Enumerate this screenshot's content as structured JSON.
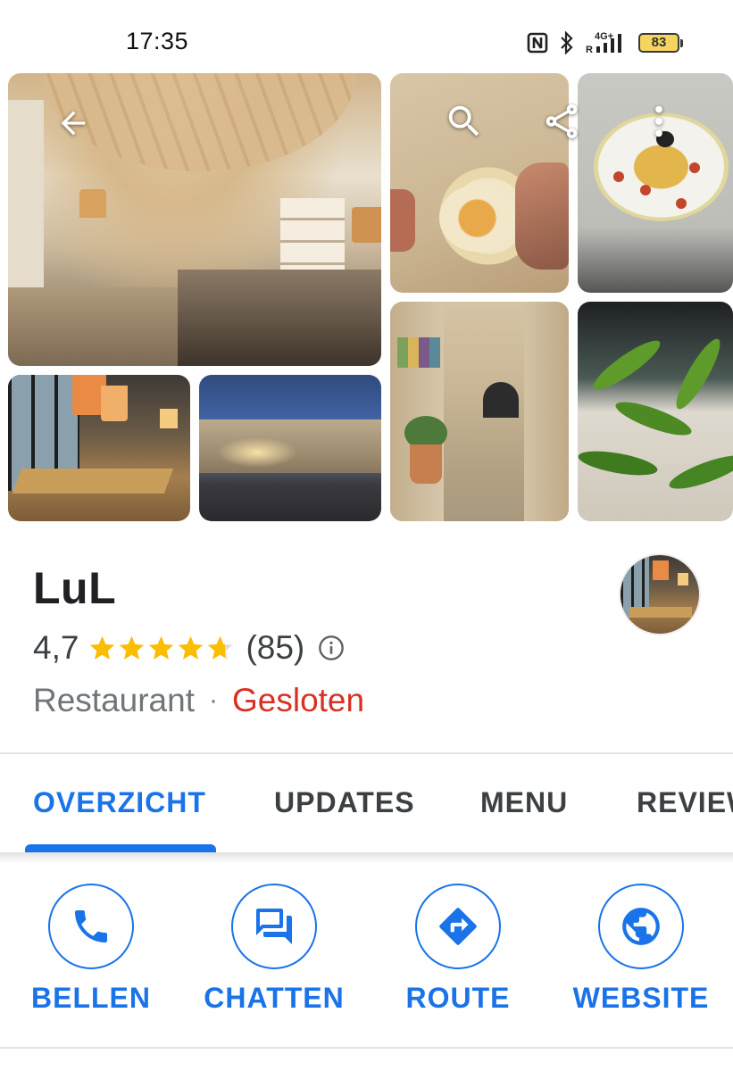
{
  "status_bar": {
    "time": "17:35",
    "battery": "83",
    "network": "4G+"
  },
  "place": {
    "name": "LuL",
    "rating": "4,7",
    "stars": 4.7,
    "review_count": "(85)",
    "category": "Restaurant",
    "separator": "·",
    "open_status": "Gesloten"
  },
  "tabs": [
    {
      "label": "OVERZICHT",
      "active": true
    },
    {
      "label": "UPDATES",
      "active": false
    },
    {
      "label": "MENU",
      "active": false
    },
    {
      "label": "REVIEWS",
      "active": false
    }
  ],
  "actions": [
    {
      "label": "BELLEN",
      "icon": "phone-icon"
    },
    {
      "label": "CHATTEN",
      "icon": "chat-icon"
    },
    {
      "label": "ROUTE",
      "icon": "directions-icon"
    },
    {
      "label": "WEBSITE",
      "icon": "globe-icon"
    }
  ],
  "colors": {
    "accent": "#1a73e8",
    "star": "#fbbc04",
    "closed": "#d93025",
    "battery": "#f5d560"
  }
}
